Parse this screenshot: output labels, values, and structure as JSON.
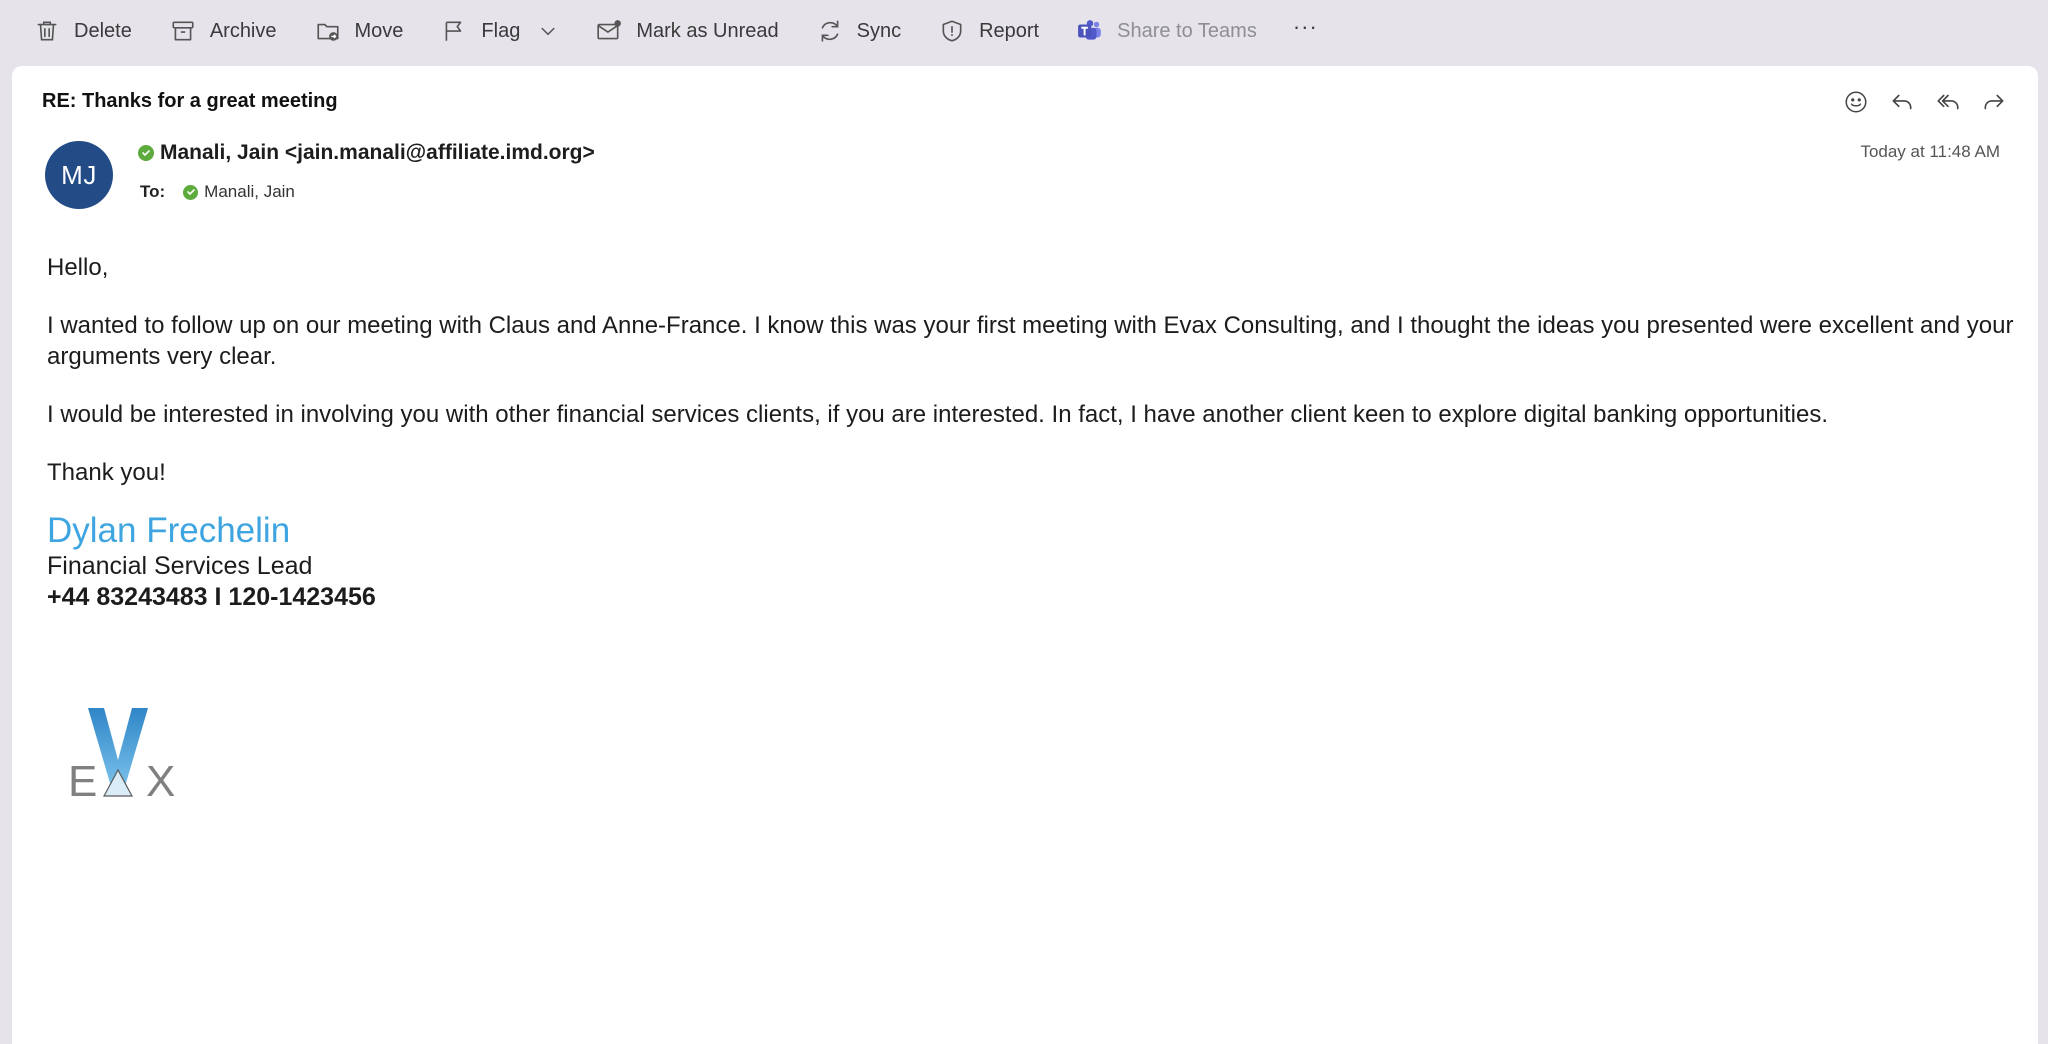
{
  "toolbar": {
    "delete": "Delete",
    "archive": "Archive",
    "move": "Move",
    "flag": "Flag",
    "mark_unread": "Mark as Unread",
    "sync": "Sync",
    "report": "Report",
    "share_teams": "Share to Teams",
    "more": "···"
  },
  "message": {
    "subject": "RE: Thanks for a great meeting",
    "avatar_initials": "MJ",
    "avatar_color": "#234c86",
    "sender": "Manali, Jain <jain.manali@affiliate.imd.org>",
    "to_label": "To:",
    "recipient": "Manali, Jain",
    "timestamp": "Today at 11:48 AM",
    "presence_color": "#5dab3d"
  },
  "body": {
    "greeting": "Hello,",
    "paragraph1": "I wanted to follow up on our meeting with Claus and Anne-France. I know this was your first meeting with Evax Consulting, and I thought the ideas you presented were excellent and your arguments very clear.",
    "paragraph2": "I would be interested in involving you with other financial services clients, if you are interested. In fact, I have another client keen to explore digital banking opportunities.",
    "closing": "Thank you!"
  },
  "signature": {
    "name": "Dylan Frechelin",
    "title": "Financial Services Lead",
    "phone": "+44 83243483 I 120-1423456",
    "name_color": "#3fa5e0",
    "logo_text": "EVAX"
  },
  "icons": {
    "delete": "trash-icon",
    "archive": "archive-box-icon",
    "move": "folder-move-icon",
    "flag": "flag-icon",
    "mark_unread": "envelope-icon",
    "sync": "sync-icon",
    "report": "shield-icon",
    "share_teams": "teams-icon",
    "emoji": "smiley-icon",
    "reply": "reply-icon",
    "reply_all": "reply-all-icon",
    "forward": "forward-icon"
  }
}
